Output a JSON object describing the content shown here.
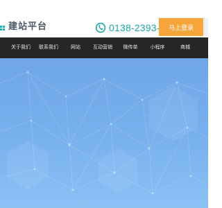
{
  "header": {
    "logo_text": "建站平台",
    "phone": "0138-2393-6940",
    "login_label": "马上登录",
    "colors": {
      "accent": "#1aa6a6",
      "login_bg": "#f5a53a"
    }
  },
  "nav": {
    "items": [
      {
        "label": "关于我们"
      },
      {
        "label": "联系我们"
      },
      {
        "label": "网站"
      },
      {
        "label": "互动营销"
      },
      {
        "label": "微传单"
      },
      {
        "label": "小程序"
      },
      {
        "label": "商城"
      }
    ],
    "colors": {
      "background": "#262626",
      "text": "#e6e6e6"
    }
  },
  "banner": {
    "colors": {
      "top": "#6fa6e8",
      "bottom": "#8bc1f5"
    }
  }
}
